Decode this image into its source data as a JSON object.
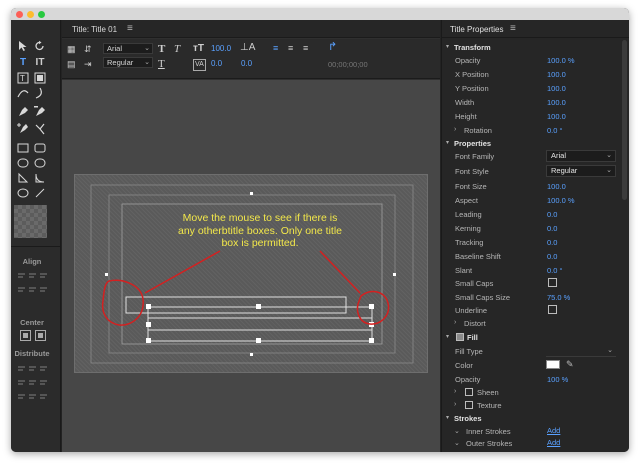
{
  "window": {
    "traffic_lights": [
      "close",
      "minimize",
      "zoom"
    ]
  },
  "center_panel": {
    "tab_title": "Title: Title 01",
    "tab_menu": "≡",
    "toolbar": {
      "font_family": "Arial",
      "font_style": "Regular",
      "font_size": "100.0",
      "leading": "0.0",
      "tracking": "0.0",
      "timecode": "00;00;00;00"
    },
    "instruction_text": "Move the mouse to see if there is any otherbtitle boxes. Only one title box is permitted."
  },
  "tools_panel": {
    "align_label": "Align",
    "center_label": "Center",
    "distribute_label": "Distribute"
  },
  "properties": {
    "title": "Title Properties",
    "menu": "≡",
    "transform": {
      "label": "Transform",
      "rows": [
        {
          "label": "Opacity",
          "value": "100.0 %"
        },
        {
          "label": "X Position",
          "value": "100.0"
        },
        {
          "label": "Y Position",
          "value": "100.0"
        },
        {
          "label": "Width",
          "value": "100.0"
        },
        {
          "label": "Height",
          "value": "100.0"
        }
      ],
      "rotation_label": "Rotation",
      "rotation_value": "0.0 °"
    },
    "props_section": {
      "label": "Properties",
      "font_family_label": "Font Family",
      "font_family_value": "Arial",
      "font_style_label": "Font Style",
      "font_style_value": "Regular",
      "rows": [
        {
          "label": "Font Size",
          "value": "100.0"
        },
        {
          "label": "Aspect",
          "value": "100.0 %"
        },
        {
          "label": "Leading",
          "value": "0.0"
        },
        {
          "label": "Kerning",
          "value": "0.0"
        },
        {
          "label": "Tracking",
          "value": "0.0"
        },
        {
          "label": "Baseline Shift",
          "value": "0.0"
        },
        {
          "label": "Slant",
          "value": "0.0 °"
        }
      ],
      "small_caps_label": "Small Caps",
      "small_caps_size_label": "Small Caps Size",
      "small_caps_size_value": "75.0 %",
      "underline_label": "Underline",
      "distort_label": "Distort"
    },
    "fill": {
      "label": "Fill",
      "fill_type_label": "Fill Type",
      "color_label": "Color",
      "color_value": "#ffffff",
      "opacity_label": "Opacity",
      "opacity_value": "100 %",
      "sheen_label": "Sheen",
      "texture_label": "Texture"
    },
    "strokes": {
      "label": "Strokes",
      "inner_label": "Inner Strokes",
      "inner_action": "Add",
      "outer_label": "Outer Strokes",
      "outer_action": "Add"
    }
  },
  "colors": {
    "accent": "#5aa1ff",
    "annotation_text": "#f3e84a",
    "annotation_circle": "#d42020",
    "panel_bg": "#262626",
    "canvas_bg": "#474747"
  }
}
